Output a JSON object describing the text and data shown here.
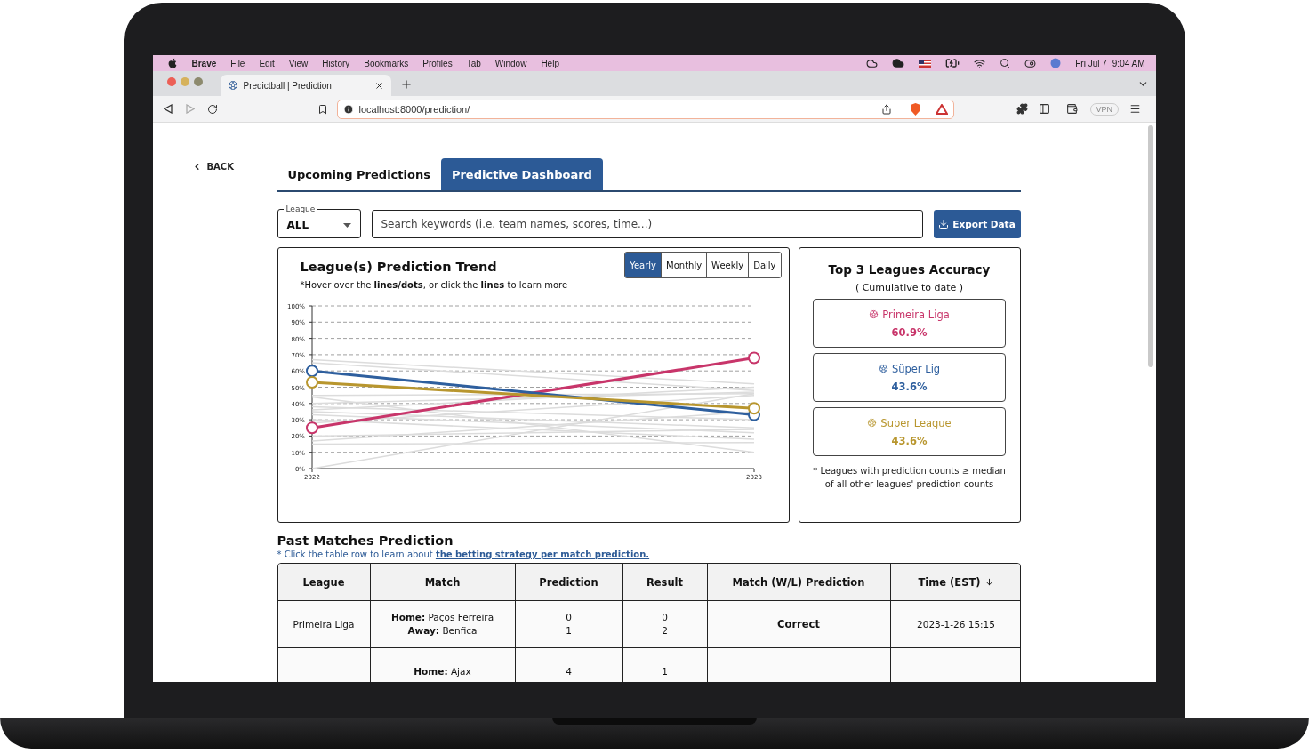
{
  "menu_bar": {
    "app": "Brave",
    "items": [
      "File",
      "Edit",
      "View",
      "History",
      "Bookmarks",
      "Profiles",
      "Tab",
      "Window",
      "Help"
    ],
    "date": "Fri Jul 7",
    "time": "9:04 AM"
  },
  "browser": {
    "tab_title": "Predictball | Prediction",
    "url": "localhost:8000/prediction/",
    "vpn": "VPN"
  },
  "page": {
    "back": "BACK",
    "tabs": [
      {
        "label": "Upcoming Predictions",
        "selected": false
      },
      {
        "label": "Predictive Dashboard",
        "selected": true
      }
    ],
    "league_filter": {
      "label": "League",
      "value": "ALL"
    },
    "search": {
      "placeholder": "Search keywords (i.e. team names, scores, time...)"
    },
    "export_button": "Export Data",
    "trend_card": {
      "title": "League(s) Prediction Trend",
      "subtitle": "*Hover over the **lines/dots**, or click the **lines** to learn more",
      "periods": [
        {
          "label": "Yearly",
          "selected": true
        },
        {
          "label": "Monthly",
          "selected": false
        },
        {
          "label": "Weekly",
          "selected": false
        },
        {
          "label": "Daily",
          "selected": false
        }
      ],
      "chart_data": {
        "type": "line",
        "categories": [
          "2022",
          "2023"
        ],
        "ylim": [
          0,
          100
        ],
        "yticks": [
          {
            "value": 0,
            "label": "0%"
          },
          {
            "value": 10,
            "label": "10%"
          },
          {
            "value": 20,
            "label": "20%"
          },
          {
            "value": 30,
            "label": "30%"
          },
          {
            "value": 40,
            "label": "40%"
          },
          {
            "value": 50,
            "label": "50%"
          },
          {
            "value": 60,
            "label": "60%"
          },
          {
            "value": 70,
            "label": "70%"
          },
          {
            "value": 80,
            "label": "80%"
          },
          {
            "value": 90,
            "label": "90%"
          },
          {
            "value": 100,
            "label": "100%"
          }
        ],
        "ref_lines": [
          {
            "axis": "y",
            "value": 10
          },
          {
            "axis": "y",
            "value": 20
          },
          {
            "axis": "y",
            "value": 30
          },
          {
            "axis": "y",
            "value": 40
          },
          {
            "axis": "y",
            "value": 50
          },
          {
            "axis": "y",
            "value": 60
          },
          {
            "axis": "y",
            "value": 70
          },
          {
            "axis": "y",
            "value": 80
          },
          {
            "axis": "y",
            "value": 90
          },
          {
            "axis": "y",
            "value": 100
          }
        ],
        "series": [
          {
            "color": "#dcdcdc",
            "values": [
              67,
              52
            ]
          },
          {
            "color": "#dcdcdc",
            "values": [
              65,
              48
            ]
          },
          {
            "color": "#dcdcdc",
            "values": [
              45,
              46
            ]
          },
          {
            "color": "#dcdcdc",
            "values": [
              40,
              47
            ]
          },
          {
            "color": "#dcdcdc",
            "values": [
              38,
              30
            ]
          },
          {
            "color": "#dcdcdc",
            "values": [
              35,
              25
            ]
          },
          {
            "color": "#dcdcdc",
            "values": [
              33,
              22
            ]
          },
          {
            "color": "#dcdcdc",
            "values": [
              30,
              18
            ]
          },
          {
            "color": "#dcdcdc",
            "values": [
              28,
              45
            ]
          },
          {
            "color": "#dcdcdc",
            "values": [
              20,
              24
            ]
          },
          {
            "color": "#dcdcdc",
            "values": [
              17,
              35
            ]
          },
          {
            "color": "#dcdcdc",
            "values": [
              15,
              16
            ]
          },
          {
            "color": "#dcdcdc",
            "values": [
              0,
              46
            ]
          },
          {
            "color": "#dcdcdc",
            "values": [
              44,
              10
            ]
          },
          {
            "color": "#dcdcdc",
            "values": [
              36,
              50
            ]
          },
          {
            "color": "#c8356a",
            "values": [
              25,
              68
            ],
            "marker": true
          },
          {
            "color": "#2e5f9e",
            "values": [
              60,
              33
            ],
            "marker": true
          },
          {
            "color": "#b8962e",
            "values": [
              53,
              37
            ],
            "marker": true
          }
        ]
      }
    },
    "accuracy_card": {
      "title": "Top 3 Leagues Accuracy",
      "subtitle": "( Cumulative to date )",
      "leagues": [
        {
          "name": "Primeira Liga",
          "value": "60.9%",
          "color": "#c8356a"
        },
        {
          "name": "Süper Lig",
          "value": "43.6%",
          "color": "#2e5f9e"
        },
        {
          "name": "Super League",
          "value": "43.6%",
          "color": "#b8962e"
        }
      ],
      "note": "* Leagues with prediction counts ≥ median of all other leagues' prediction counts"
    },
    "past_matches": {
      "title": "Past Matches Prediction",
      "note": "* Click the table row to learn about ",
      "note_link": "the betting strategy per match prediction.",
      "columns": [
        {
          "label": "League",
          "sorted": false
        },
        {
          "label": "Match",
          "sorted": false
        },
        {
          "label": "Prediction",
          "sorted": false
        },
        {
          "label": "Result",
          "sorted": false
        },
        {
          "label": "Match (W/L) Prediction",
          "sorted": false
        },
        {
          "label": "Time (EST)",
          "sorted": true
        }
      ],
      "rows": [
        {
          "league": "Primeira Liga",
          "match": [
            "**Home:** Paços Ferreira",
            "**Away:** Benfica"
          ],
          "prediction": [
            "0",
            "1"
          ],
          "result": [
            "0",
            "2"
          ],
          "outcome": "Correct",
          "time": "2023-1-26 15:15"
        },
        {
          "match": [
            "**Home:** Ajax"
          ],
          "prediction": [
            "4"
          ],
          "result": [
            "1"
          ]
        }
      ]
    }
  }
}
